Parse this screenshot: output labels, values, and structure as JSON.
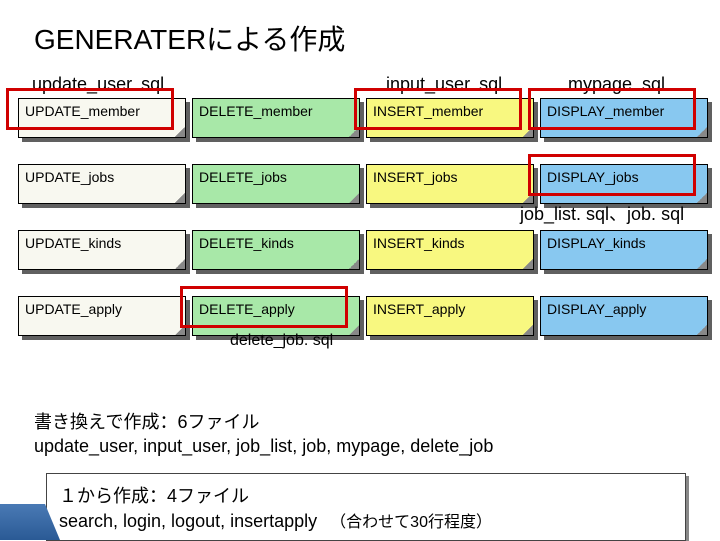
{
  "title": "GENERATERによる作成",
  "col_labels": {
    "update": "update_user. sql",
    "input": "input_user. sql",
    "mypage": "mypage. sql"
  },
  "mid_label": "job_list. sql、job. sql",
  "delete_label": "delete_job. sql",
  "grid": [
    [
      "UPDATE_member",
      "DELETE_member",
      "INSERT_member",
      "DISPLAY_member"
    ],
    [
      "UPDATE_jobs",
      "DELETE_jobs",
      "INSERT_jobs",
      "DISPLAY_jobs"
    ],
    [
      "UPDATE_kinds",
      "DELETE_kinds",
      "INSERT_kinds",
      "DISPLAY_kinds"
    ],
    [
      "UPDATE_apply",
      "DELETE_apply",
      "INSERT_apply",
      "DISPLAY_apply"
    ]
  ],
  "summary1_line1": "書き換えで作成：6ファイル",
  "summary1_line2": "update_user, input_user, job_list, job, mypage, delete_job",
  "summary2_line1": "１から作成：4ファイル",
  "summary2_line2": "search, login, logout, insertapply",
  "summary2_note": "（合わせて30行程度）"
}
